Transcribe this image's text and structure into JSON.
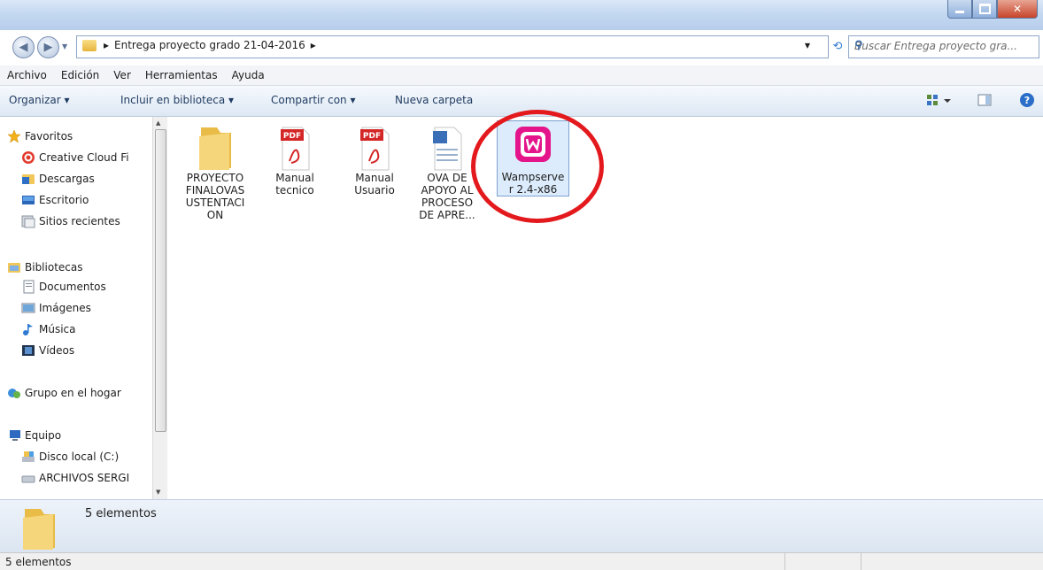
{
  "window": {
    "breadcrumb": "Entrega proyecto grado 21-04-2016",
    "search_placeholder": "Buscar Entrega proyecto gra..."
  },
  "menu": [
    "Archivo",
    "Edición",
    "Ver",
    "Herramientas",
    "Ayuda"
  ],
  "toolbar": {
    "organize": "Organizar ▾",
    "include_library": "Incluir en biblioteca ▾",
    "share": "Compartir con ▾",
    "new_folder": "Nueva carpeta"
  },
  "nav": {
    "favorites_header": "Favoritos",
    "favorites": [
      "Creative Cloud Fi",
      "Descargas",
      "Escritorio",
      "Sitios recientes"
    ],
    "libraries_header": "Bibliotecas",
    "libraries": [
      "Documentos",
      "Imágenes",
      "Música",
      "Vídeos"
    ],
    "homegroup": "Grupo en el hogar",
    "computer_header": "Equipo",
    "computer": [
      "Disco local (C:)",
      "ARCHIVOS SERGI"
    ]
  },
  "files": [
    {
      "name": "PROYECTO FINALOVASUSTENTACION",
      "label_lines": [
        "PROYECTO",
        "FINALOVAS",
        "USTENTACI",
        "ON"
      ],
      "type": "folder-icon"
    },
    {
      "name": "Manual tecnico",
      "label_lines": [
        "Manual",
        "tecnico"
      ],
      "type": "pdf-icon"
    },
    {
      "name": "Manual Usuario",
      "label_lines": [
        "Manual",
        "Usuario"
      ],
      "type": "pdf-icon"
    },
    {
      "name": "OVA DE APOYO AL PROCESO DE APRE...",
      "label_lines": [
        "OVA DE",
        "APOYO AL",
        "PROCESO",
        "DE APRE..."
      ],
      "type": "word-doc-icon"
    },
    {
      "name": "Wampserver 2.4-x86",
      "label_lines": [
        "Wampserve",
        "r 2.4-x86"
      ],
      "type": "wampserver-icon"
    }
  ],
  "pdf_badge": "PDF",
  "details_pane": {
    "count_text": "5 elementos"
  },
  "status_bar": {
    "count_text": "5 elementos"
  },
  "colors": {
    "annotation_circle": "#e3191d",
    "wamp_pink": "#e4148b"
  }
}
